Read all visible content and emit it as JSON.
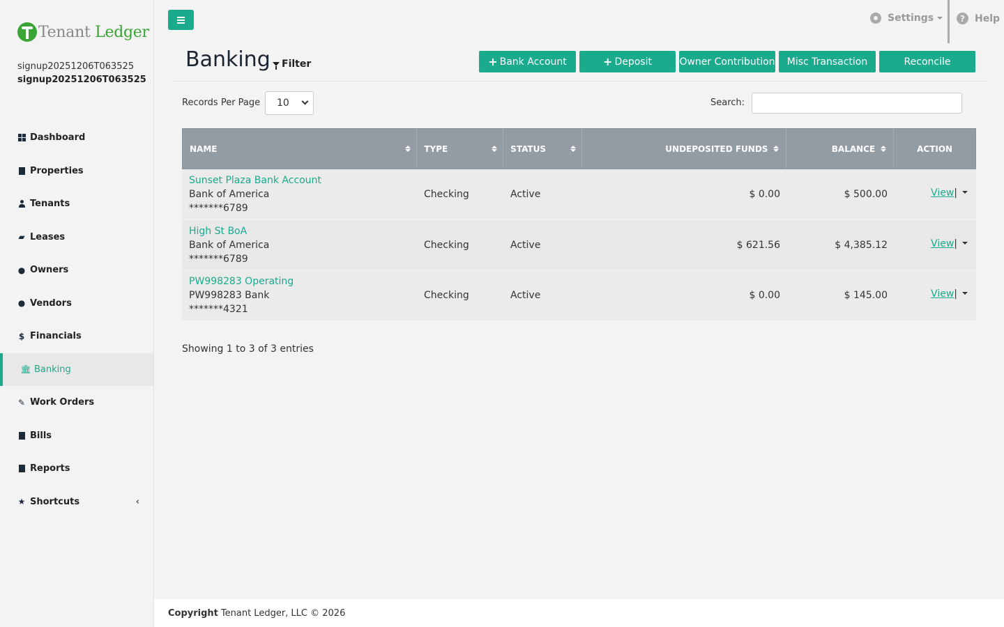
{
  "brand": {
    "part1": "Tenant",
    "part2": "Ledger"
  },
  "user": {
    "name": "signup20251206T063525",
    "company": "signup20251206T063525"
  },
  "nav": [
    {
      "label": "Dashboard",
      "icon": "dashboard-icon"
    },
    {
      "label": "Properties",
      "icon": "building-icon"
    },
    {
      "label": "Tenants",
      "icon": "user-icon"
    },
    {
      "label": "Leases",
      "icon": "folder-open-icon"
    },
    {
      "label": "Owners",
      "icon": "users-icon"
    },
    {
      "label": "Vendors",
      "icon": "users-icon"
    },
    {
      "label": "Financials",
      "icon": "dollar-icon"
    },
    {
      "label": "Banking",
      "icon": "bank-icon",
      "active": true
    },
    {
      "label": "Work Orders",
      "icon": "edit-icon"
    },
    {
      "label": "Bills",
      "icon": "file-icon"
    },
    {
      "label": "Reports",
      "icon": "file-text-icon"
    },
    {
      "label": "Shortcuts",
      "icon": "star-icon",
      "chevron": "‹"
    }
  ],
  "topbar": {
    "settings": "Settings",
    "help": "Help"
  },
  "page": {
    "title": "Banking",
    "filter": "Filter",
    "actions": {
      "bank_account": "Bank Account",
      "deposit": "Deposit",
      "owner_contribution": "Owner Contribution",
      "misc_transaction": "Misc Transaction",
      "reconcile": "Reconcile"
    },
    "records_per_page_label": "Records Per Page",
    "records_per_page_value": "10",
    "search_label": "Search:",
    "search_value": ""
  },
  "table": {
    "columns": {
      "name": "NAME",
      "type": "TYPE",
      "status": "STATUS",
      "undeposited": "UNDEPOSITED FUNDS",
      "balance": "BALANCE",
      "action": "ACTION"
    },
    "rows": [
      {
        "name": "Sunset Plaza Bank Account",
        "bank": "Bank of America",
        "account": "*******6789",
        "type": "Checking",
        "status": "Active",
        "undeposited": "$ 0.00",
        "balance": "$ 500.00",
        "view": "View",
        "sep": "|"
      },
      {
        "name": "High St BoA",
        "bank": "Bank of America",
        "account": "*******6789",
        "type": "Checking",
        "status": "Active",
        "undeposited": "$ 621.56",
        "balance": "$ 4,385.12",
        "view": "View",
        "sep": "|"
      },
      {
        "name": "PW998283 Operating",
        "bank": "PW998283 Bank",
        "account": "*******4321",
        "type": "Checking",
        "status": "Active",
        "undeposited": "$ 0.00",
        "balance": "$ 145.00",
        "view": "View",
        "sep": "|"
      }
    ],
    "info": "Showing 1 to 3 of 3 entries"
  },
  "footer": {
    "copyright_label": "Copyright",
    "text": "Tenant Ledger, LLC © 2026"
  },
  "colors": {
    "accent": "#1aaa8c",
    "header_bg": "#939ba3",
    "brand_green": "#3aa535"
  }
}
